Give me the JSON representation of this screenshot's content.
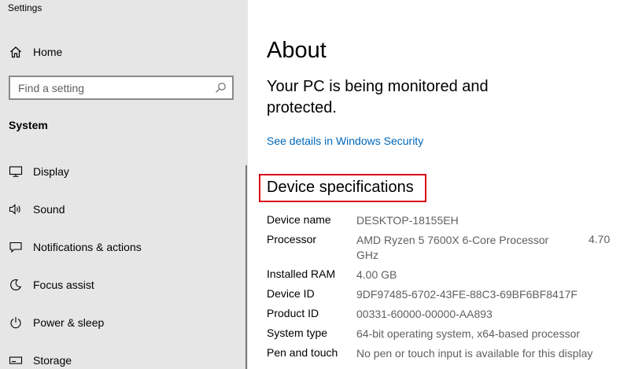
{
  "window": {
    "title": "Settings"
  },
  "sidebar": {
    "home_label": "Home",
    "search": {
      "placeholder": "Find a setting"
    },
    "section_heading": "System",
    "items": [
      {
        "label": "Display",
        "icon": "display-icon"
      },
      {
        "label": "Sound",
        "icon": "sound-icon"
      },
      {
        "label": "Notifications & actions",
        "icon": "notifications-icon"
      },
      {
        "label": "Focus assist",
        "icon": "focus-assist-icon"
      },
      {
        "label": "Power & sleep",
        "icon": "power-icon"
      },
      {
        "label": "Storage",
        "icon": "storage-icon"
      }
    ]
  },
  "main": {
    "title": "About",
    "status_text": "Your PC is being monitored and protected.",
    "security_link": "See details in Windows Security",
    "spec_heading": "Device specifications",
    "specs": [
      {
        "label": "Device name",
        "value": "DESKTOP-18155EH"
      },
      {
        "label": "Processor",
        "value": "AMD Ryzen 5 7600X 6-Core Processor GHz",
        "value_extra": "4.70"
      },
      {
        "label": "Installed RAM",
        "value": "4.00 GB"
      },
      {
        "label": "Device ID",
        "value": "9DF97485-6702-43FE-88C3-69BF6BF8417F"
      },
      {
        "label": "Product ID",
        "value": "00331-60000-00000-AA893"
      },
      {
        "label": "System type",
        "value": "64-bit operating system, x64-based processor"
      },
      {
        "label": "Pen and touch",
        "value": "No pen or touch input is available for this display"
      }
    ]
  },
  "colors": {
    "sidebar_bg": "#e6e6e6",
    "link": "#0067b8",
    "highlight_border": "#d6001c",
    "value_text": "#5f5f5f"
  }
}
